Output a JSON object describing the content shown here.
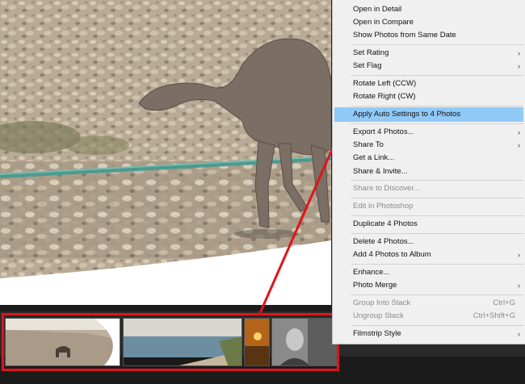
{
  "menu": {
    "items": [
      {
        "label": "Open in Detail"
      },
      {
        "label": "Open in Compare"
      },
      {
        "label": "Show Photos from Same Date"
      },
      {
        "label": "Set Rating",
        "arrow": "›"
      },
      {
        "label": "Set Flag",
        "arrow": "›"
      },
      {
        "label": "Rotate Left (CCW)"
      },
      {
        "label": "Rotate Right (CW)"
      },
      {
        "label": "Apply Auto Settings to 4 Photos"
      },
      {
        "label": "Export 4 Photos...",
        "arrow": "›"
      },
      {
        "label": "Share To",
        "arrow": "›"
      },
      {
        "label": "Get a Link..."
      },
      {
        "label": "Share & Invite..."
      },
      {
        "label": "Share to Discover..."
      },
      {
        "label": "Edit in Photoshop"
      },
      {
        "label": "Duplicate 4 Photos"
      },
      {
        "label": "Delete 4 Photos..."
      },
      {
        "label": "Add 4 Photos to Album",
        "arrow": "›"
      },
      {
        "label": "Enhance..."
      },
      {
        "label": "Photo Merge",
        "arrow": "›"
      },
      {
        "label": "Group Into Stack",
        "shortcut": "Ctrl+G"
      },
      {
        "label": "Ungroup Stack",
        "shortcut": "Ctrl+Shift+G"
      },
      {
        "label": "Filmstrip Style",
        "arrow": "›"
      }
    ]
  },
  "colors": {
    "highlight": "#91c9f7",
    "annotation_red": "#e0141a",
    "menu_background": "#f0f0f0"
  }
}
